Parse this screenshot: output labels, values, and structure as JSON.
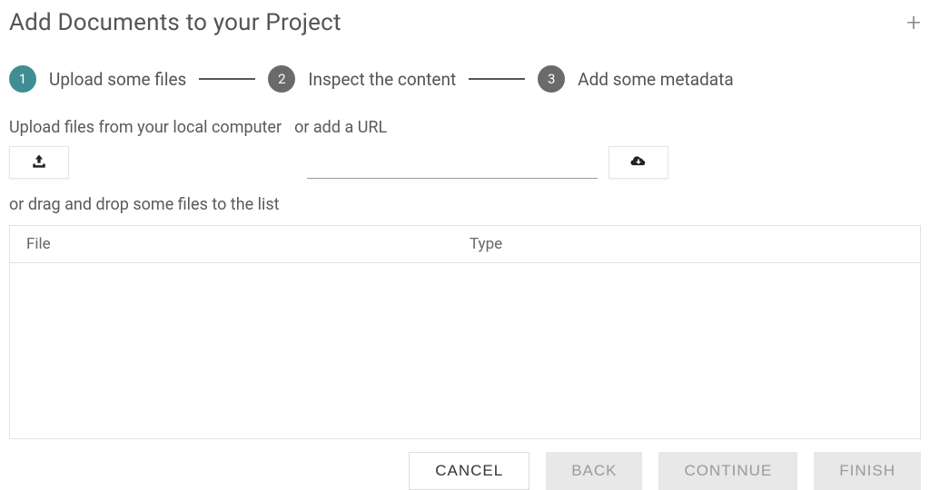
{
  "header": {
    "title": "Add Documents to your Project"
  },
  "stepper": {
    "steps": [
      {
        "num": "1",
        "label": "Upload some files",
        "active": true
      },
      {
        "num": "2",
        "label": "Inspect the content",
        "active": false
      },
      {
        "num": "3",
        "label": "Add some metadata",
        "active": false
      }
    ]
  },
  "upload": {
    "local_label": "Upload files from your local computer",
    "url_label": "or add a URL",
    "url_value": "",
    "drag_hint": "or drag and drop some files to the list"
  },
  "table": {
    "headers": {
      "file": "File",
      "type": "Type"
    },
    "rows": []
  },
  "buttons": {
    "cancel": "CANCEL",
    "back": "BACK",
    "continue": "CONTINUE",
    "finish": "FINISH"
  },
  "colors": {
    "active_step": "#3f8e94",
    "inactive_step": "#6a6a6a"
  }
}
